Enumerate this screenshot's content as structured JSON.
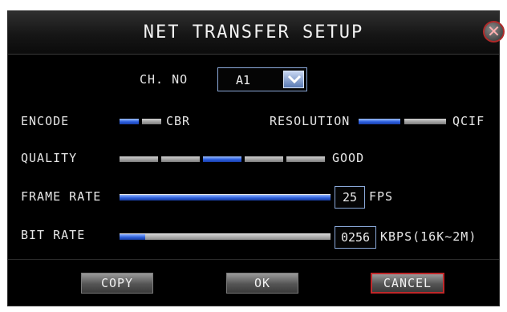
{
  "dialog": {
    "title": "NET TRANSFER SETUP",
    "close_icon": "close-icon",
    "channel": {
      "label": "CH. NO",
      "value": "A1"
    },
    "encode": {
      "label": "ENCODE",
      "value": "CBR",
      "levels": 2,
      "selected_level": 1
    },
    "resolution": {
      "label": "RESOLUTION",
      "value": "QCIF",
      "levels": 2,
      "selected_level": 1
    },
    "quality": {
      "label": "QUALITY",
      "value": "GOOD",
      "levels": 5,
      "selected_level": 3
    },
    "frame_rate": {
      "label": "FRAME RATE",
      "value": "25",
      "unit": "FPS",
      "fill_fraction": 1.0
    },
    "bit_rate": {
      "label": "BIT RATE",
      "value": "0256",
      "unit": "KBPS(16K~2M)",
      "fill_fraction": 0.12
    },
    "buttons": {
      "copy": "COPY",
      "ok": "OK",
      "cancel": "CANCEL"
    }
  },
  "colors": {
    "accent_blue": "#2c5fe0",
    "cancel_border": "#c0282a",
    "background": "#000000"
  }
}
